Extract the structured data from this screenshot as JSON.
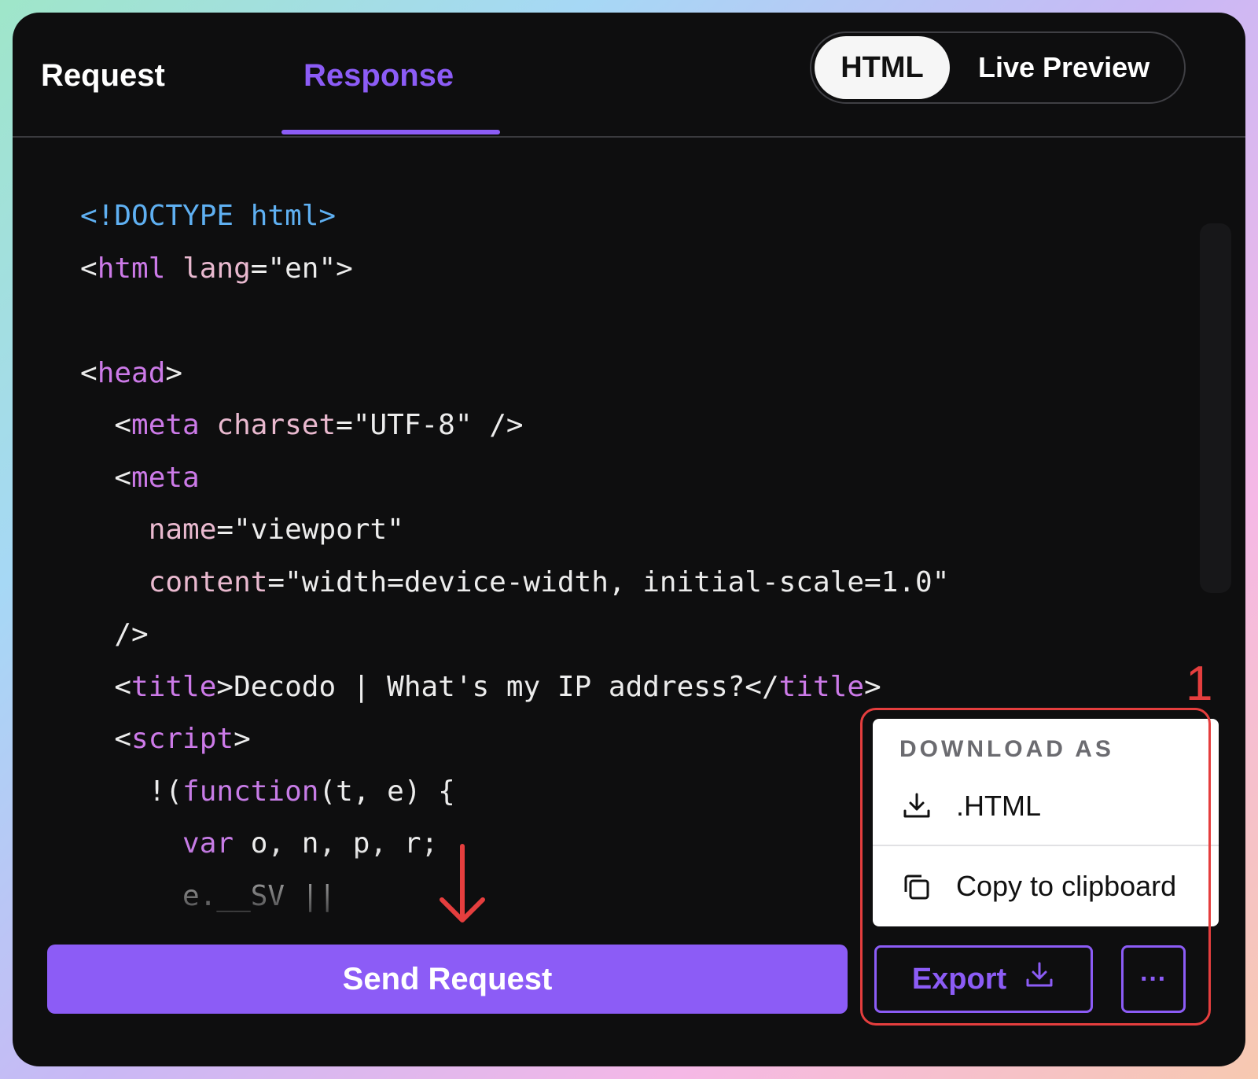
{
  "tabs": {
    "request": "Request",
    "response": "Response",
    "active": "Response"
  },
  "view_toggle": {
    "html": "HTML",
    "live_preview": "Live Preview",
    "active": "HTML"
  },
  "code_lines": [
    "<!DOCTYPE html>",
    "<html lang=\"en\">",
    "",
    "<head>",
    "  <meta charset=\"UTF-8\" />",
    "  <meta",
    "    name=\"viewport\"",
    "    content=\"width=device-width, initial-scale=1.0\"",
    "  />",
    "  <title>Decodo | What's my IP address?</title>",
    "  <script>",
    "    !(function(t, e) {",
    "      var o, n, p, r;",
    "      e.__SV ||"
  ],
  "buttons": {
    "send_request": "Send Request",
    "export": "Export",
    "more": "···"
  },
  "dropdown": {
    "header": "DOWNLOAD AS",
    "html": ".HTML",
    "copy": "Copy to clipboard"
  },
  "annotations": {
    "step": "1"
  },
  "colors": {
    "accent": "#8c5cf6",
    "annotation": "#e53e3e",
    "background": "#0e0e0f"
  }
}
